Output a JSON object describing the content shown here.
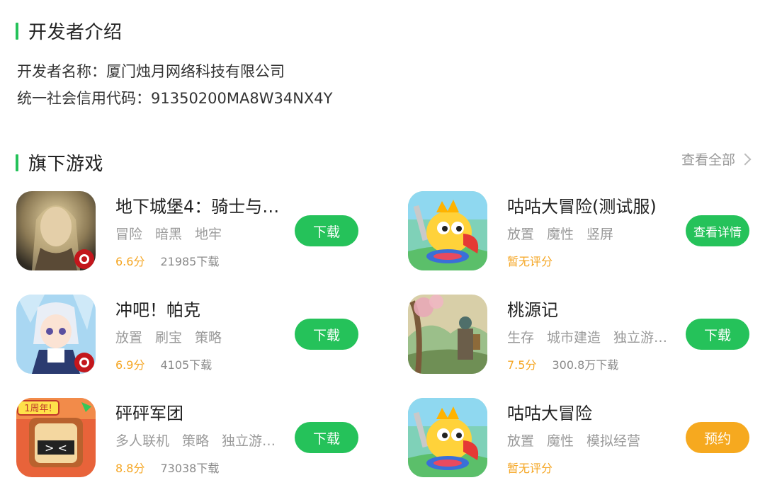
{
  "developer_section": {
    "title": "开发者介绍",
    "name_line": "开发者名称：厦门烛月网络科技有限公司",
    "code_line": "统一社会信用代码：91350200MA8W34NX4Y"
  },
  "games_section": {
    "title": "旗下游戏",
    "view_all": "查看全部"
  },
  "games": [
    {
      "name": "地下城堡4：骑士与…",
      "tags": [
        "冒险",
        "暗黑",
        "地牢"
      ],
      "score": "6.6分",
      "downloads": "21985下载",
      "button": "下载"
    },
    {
      "name": "咕咕大冒险(测试服)",
      "tags": [
        "放置",
        "魔性",
        "竖屏"
      ],
      "score": "暂无评分",
      "downloads": "",
      "button": "查看详情"
    },
    {
      "name": "冲吧！帕克",
      "tags": [
        "放置",
        "刷宝",
        "策略"
      ],
      "score": "6.9分",
      "downloads": "4105下载",
      "button": "下载"
    },
    {
      "name": "桃源记",
      "tags": [
        "生存",
        "城市建造",
        "独立游…"
      ],
      "score": "7.5分",
      "downloads": "300.8万下载",
      "button": "下载"
    },
    {
      "name": "砰砰军团",
      "tags": [
        "多人联机",
        "策略",
        "独立游…"
      ],
      "score": "8.8分",
      "downloads": "73038下载",
      "button": "下载"
    },
    {
      "name": "咕咕大冒险",
      "tags": [
        "放置",
        "魔性",
        "模拟经营"
      ],
      "score": "暂无评分",
      "downloads": "",
      "button": "预约"
    }
  ],
  "badges": {
    "anniversary": "1周年!"
  },
  "colors": {
    "accent_green": "#25c25a",
    "score_orange": "#f5a623",
    "reserve_orange": "#f6a91f"
  }
}
